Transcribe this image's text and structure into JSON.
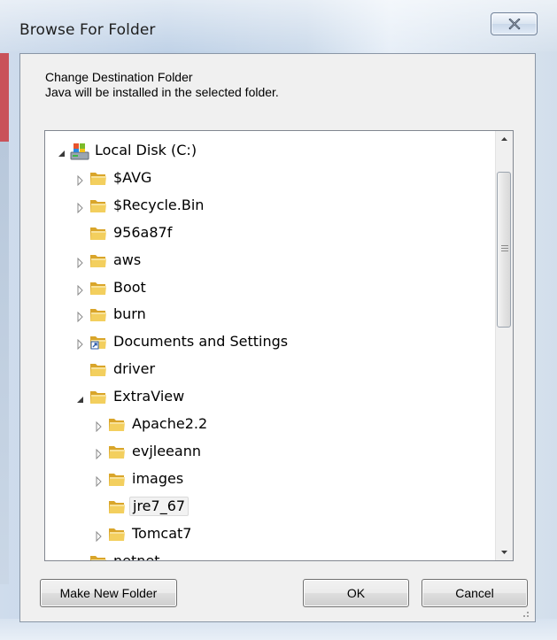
{
  "window": {
    "title": "Browse For Folder",
    "close_symbol": "✕"
  },
  "description": {
    "line1": "Change Destination Folder",
    "line2": "Java will be installed in the selected folder."
  },
  "tree": {
    "items": [
      {
        "label": "Local Disk (C:)",
        "expanded": true,
        "icon": "drive-icon"
      },
      {
        "label": "$AVG",
        "expanded": false,
        "icon": "folder-icon"
      },
      {
        "label": "$Recycle.Bin",
        "expanded": false,
        "icon": "folder-icon"
      },
      {
        "label": "956a87f",
        "icon": "folder-icon"
      },
      {
        "label": "aws",
        "expanded": false,
        "icon": "folder-icon"
      },
      {
        "label": "Boot",
        "expanded": false,
        "icon": "folder-icon"
      },
      {
        "label": "burn",
        "expanded": false,
        "icon": "folder-icon"
      },
      {
        "label": "Documents and Settings",
        "expanded": false,
        "icon": "shortcut-folder-icon"
      },
      {
        "label": "driver",
        "icon": "folder-icon"
      },
      {
        "label": "ExtraView",
        "expanded": true,
        "icon": "folder-icon"
      },
      {
        "label": "Apache2.2",
        "expanded": false,
        "icon": "folder-icon"
      },
      {
        "label": "evjleeann",
        "expanded": false,
        "icon": "folder-icon"
      },
      {
        "label": "images",
        "expanded": false,
        "icon": "folder-icon"
      },
      {
        "label": "jre7_67",
        "selected": true,
        "icon": "folder-icon"
      },
      {
        "label": "Tomcat7",
        "expanded": false,
        "icon": "folder-icon"
      },
      {
        "label": "netnet",
        "icon": "folder-icon"
      }
    ]
  },
  "buttons": {
    "make_new_folder": "Make New Folder",
    "ok": "OK",
    "cancel": "Cancel"
  },
  "colors": {
    "selection_bg": "#f2f2f2",
    "folder": "#e8b93a",
    "accent_strip": "#c9525a"
  }
}
